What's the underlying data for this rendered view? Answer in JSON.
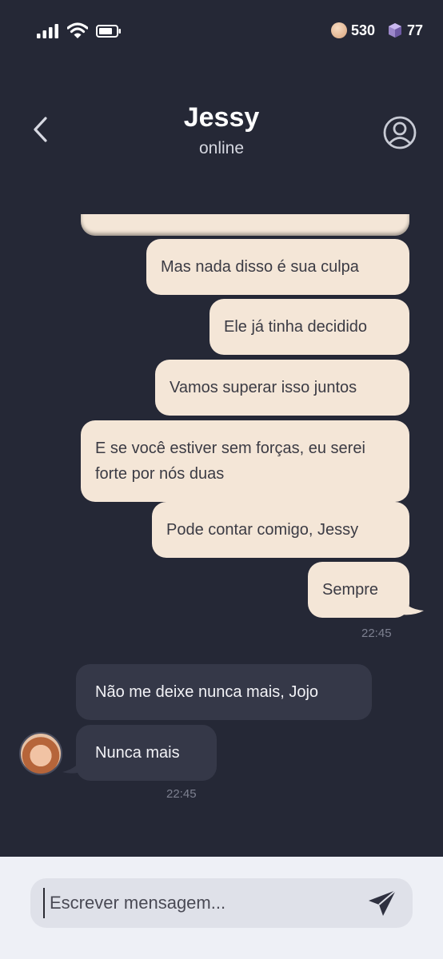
{
  "status_bar": {
    "coins": "530",
    "gems": "77"
  },
  "header": {
    "contact_name": "Jessy",
    "contact_status": "online"
  },
  "messages_out": [
    "Mas nada disso é sua culpa",
    "Ele já tinha decidido",
    "Vamos superar isso juntos",
    "E se você estiver sem forças, eu serei forte por nós duas",
    "Pode contar comigo, Jessy",
    "Sempre"
  ],
  "messages_out_time": "22:45",
  "messages_in": [
    "Não me deixe nunca mais, Jojo",
    "Nunca mais"
  ],
  "messages_in_time": "22:45",
  "composer": {
    "placeholder": "Escrever mensagem..."
  },
  "colors": {
    "background": "#252836",
    "bubble_out": "#f4e6d7",
    "bubble_in": "#353848",
    "composer_bg": "#eef0f6"
  },
  "icons": {
    "back": "chevron-left-icon",
    "profile": "user-circle-icon",
    "send": "paper-plane-icon",
    "coin": "coin-icon",
    "gem": "gem-icon"
  }
}
